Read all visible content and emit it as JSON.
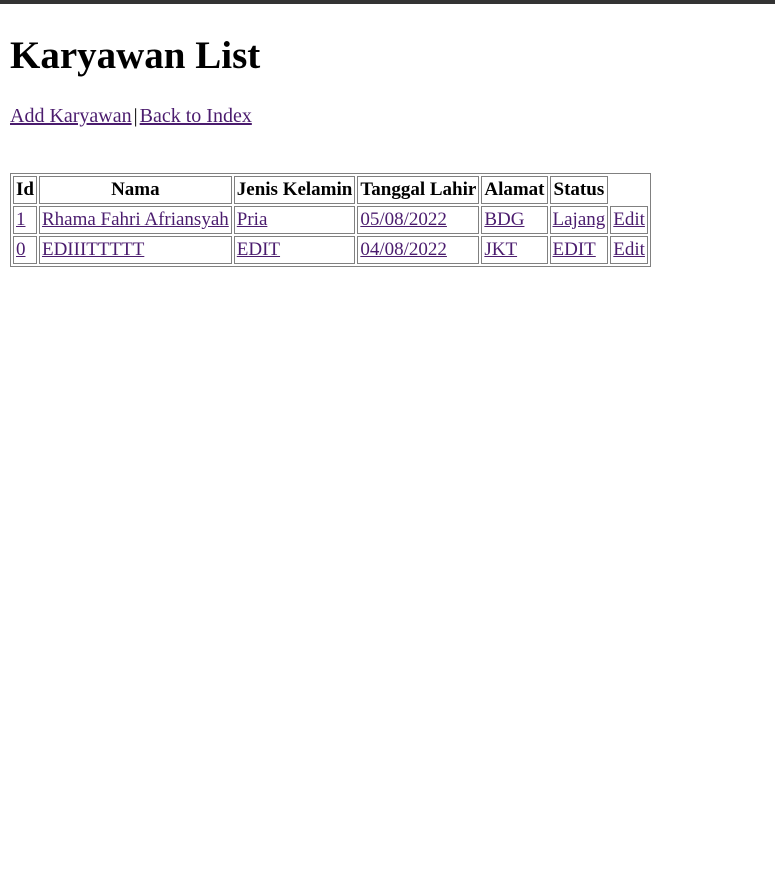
{
  "page": {
    "title": "Karyawan List"
  },
  "nav": {
    "add_label": "Add Karyawan",
    "separator": "|",
    "back_label": "Back to Index"
  },
  "table": {
    "headers": [
      "Id",
      "Nama",
      "Jenis Kelamin",
      "Tanggal Lahir",
      "Alamat",
      "Status",
      ""
    ],
    "rows": [
      {
        "id": "1",
        "nama": "Rhama Fahri Afriansyah",
        "jenis_kelamin": "Pria",
        "tanggal_lahir": "05/08/2022",
        "alamat": "BDG",
        "status": "Lajang",
        "edit": "Edit"
      },
      {
        "id": "0",
        "nama": "EDIIITTTTT",
        "jenis_kelamin": "EDIT",
        "tanggal_lahir": "04/08/2022",
        "alamat": "JKT",
        "status": "EDIT",
        "edit": "Edit"
      }
    ]
  },
  "colors": {
    "link": "#4b1c6e",
    "top_bar": "#333333"
  }
}
